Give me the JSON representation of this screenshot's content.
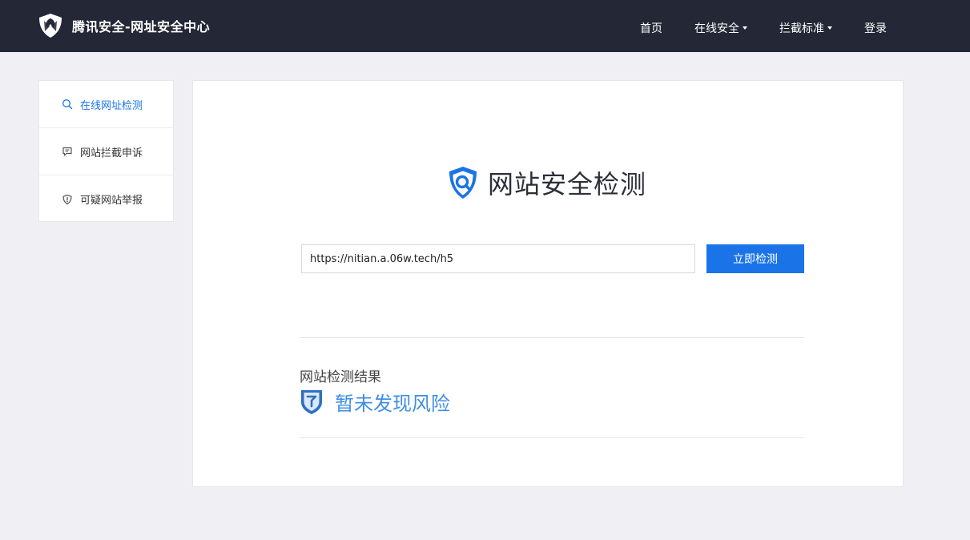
{
  "header": {
    "brand": "腾讯安全-网址安全中心",
    "nav": [
      {
        "label": "首页",
        "dropdown": false
      },
      {
        "label": "在线安全",
        "dropdown": true
      },
      {
        "label": "拦截标准",
        "dropdown": true
      },
      {
        "label": "登录",
        "dropdown": false
      }
    ]
  },
  "sidebar": {
    "items": [
      {
        "label": "在线网址检测",
        "icon": "search-icon",
        "active": true
      },
      {
        "label": "网站拦截申诉",
        "icon": "chat-icon",
        "active": false
      },
      {
        "label": "可疑网站举报",
        "icon": "shield-alert-icon",
        "active": false
      }
    ]
  },
  "main": {
    "title": "网站安全检测",
    "url_value": "https://nitian.a.06w.tech/h5",
    "check_button": "立即检测",
    "result_title": "网站检测结果",
    "result_status": "暂未发现风险"
  },
  "colors": {
    "header_bg": "#242836",
    "accent": "#1a74e8",
    "status": "#3f8ee6",
    "page_bg": "#f0f0f4"
  }
}
